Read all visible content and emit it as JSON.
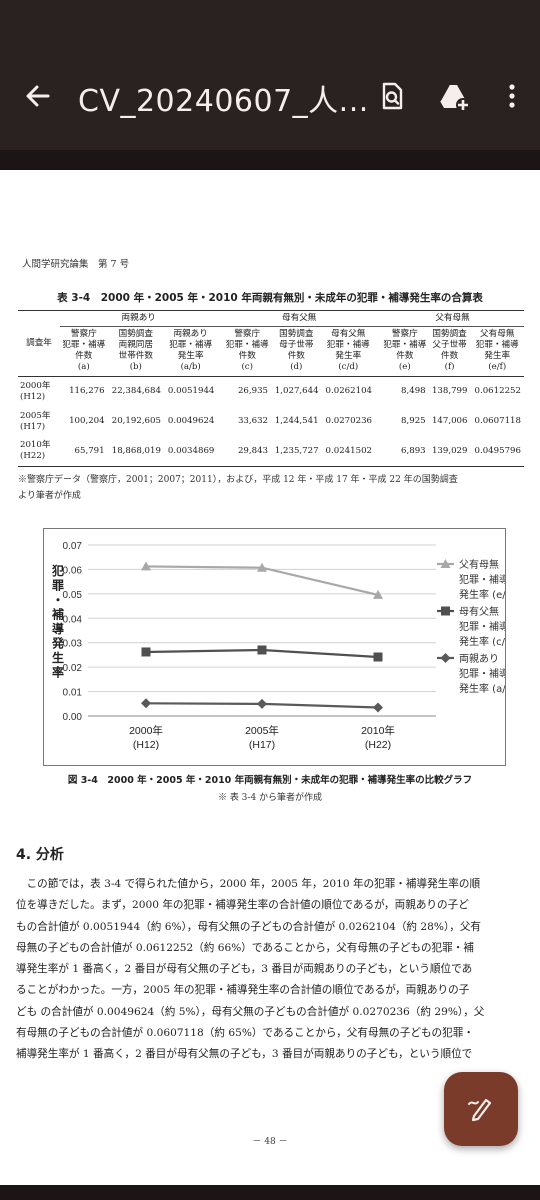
{
  "app": {
    "title": "CV_20240607_人..."
  },
  "page": {
    "header": "人間学研究論集　第 7 号",
    "table_caption": "表 3-4　2000 年・2005 年・2010 年両親有無別・未成年の犯罪・補導発生率の合算表",
    "table": {
      "groups": [
        "両親あり",
        "母有父無",
        "父有母無"
      ],
      "row_header": "調査年",
      "columns": [
        [
          "警察庁",
          "犯罪・補導",
          "件数",
          "(a)"
        ],
        [
          "国勢調査",
          "両親同居",
          "世帯件数",
          "(b)"
        ],
        [
          "両親あり",
          "犯罪・補導",
          "発生率",
          "(a/b)"
        ],
        [
          "警察庁",
          "犯罪・補導",
          "件数",
          "(c)"
        ],
        [
          "国勢調査",
          "母子世帯",
          "件数",
          "(d)"
        ],
        [
          "母有父無",
          "犯罪・補導",
          "発生率",
          "(c/d)"
        ],
        [
          "警察庁",
          "犯罪・補導",
          "件数",
          "(e)"
        ],
        [
          "国勢調査",
          "父子世帯",
          "件数",
          "(f)"
        ],
        [
          "父有母無",
          "犯罪・補導",
          "発生率",
          "(e/f)"
        ]
      ],
      "rows": [
        {
          "year": "2000年",
          "era": "(H12)",
          "values": [
            "116,276",
            "22,384,684",
            "0.0051944",
            "26,935",
            "1,027,644",
            "0.0262104",
            "8,498",
            "138,799",
            "0.0612252"
          ]
        },
        {
          "year": "2005年",
          "era": "(H17)",
          "values": [
            "100,204",
            "20,192,605",
            "0.0049624",
            "33,632",
            "1,244,541",
            "0.0270236",
            "8,925",
            "147,006",
            "0.0607118"
          ]
        },
        {
          "year": "2010年",
          "era": "(H22)",
          "values": [
            "65,791",
            "18,868,019",
            "0.0034869",
            "29,843",
            "1,235,727",
            "0.0241502",
            "6,893",
            "139,029",
            "0.0495796"
          ]
        }
      ],
      "note_line1": "※警察庁データ（警察庁，2001；2007；2011），および，平成 12 年・平成 17 年・平成 22 年の国勢調査",
      "note_line2": "より筆者が作成"
    },
    "chart_caption": "図 3-4　2000 年・2005 年・2010 年両親有無別・未成年の犯罪・補導発生率の比較グラフ",
    "chart_subcaption": "※ 表 3-4 から筆者が作成",
    "section_title": "4. 分析",
    "body_lines": [
      "　この節では，表 3-4 で得られた値から，2000 年，2005 年，2010 年の犯罪・補導発生率の順",
      "位を導きだした。まず，2000 年の犯罪・補導発生率の合計値の順位であるが，両親ありの子ど",
      "もの合計値が 0.0051944（約 6%），母有父無の子どもの合計値が 0.0262104（約 28%），父有",
      "母無の子どもの合計値が 0.0612252（約 66%）であることから，父有母無の子どもの犯罪・補",
      "導発生率が 1 番高く，2 番目が母有父無の子ども，3 番目が両親ありの子ども，という順位であ",
      "ることがわかった。一方，2005 年の犯罪・補導発生率の合計値の順位であるが，両親ありの子",
      "ども の合計値が 0.0049624（約 5%），母有父無の子どもの合計値が 0.0270236（約 29%），父",
      "有母無の子どもの合計値が 0.0607118（約 65%）であることから，父有母無の子どもの犯罪・",
      "補導発生率が 1 番高く，2 番目が母有父無の子ども，3 番目が両親ありの子ども，という順位で"
    ],
    "page_number": "－ 48 －"
  },
  "chart_data": {
    "type": "line",
    "ylabel": "犯罪・補導発生率",
    "ylim": [
      0,
      0.07
    ],
    "yticks": [
      "0.00",
      "0.01",
      "0.02",
      "0.03",
      "0.04",
      "0.05",
      "0.06",
      "0.07"
    ],
    "categories": [
      "2000年",
      "2005年",
      "2010年"
    ],
    "category_sub": [
      "(H12)",
      "(H17)",
      "(H22)"
    ],
    "grid": true,
    "legend_position": "right",
    "series": [
      {
        "name": "父有母無",
        "legend_lines": [
          "父有母無",
          "犯罪・補導",
          "発生率 (e/f)"
        ],
        "marker": "triangle",
        "color": "#a8a8a8",
        "values": [
          0.0612252,
          0.0607118,
          0.0495796
        ]
      },
      {
        "name": "母有父無",
        "legend_lines": [
          "母有父無",
          "犯罪・補導",
          "発生率 (c/d)"
        ],
        "marker": "square",
        "color": "#505050",
        "values": [
          0.0262104,
          0.0270236,
          0.0241502
        ]
      },
      {
        "name": "両親あり",
        "legend_lines": [
          "両親あり",
          "犯罪・補導",
          "発生率 (a/b)"
        ],
        "marker": "diamond",
        "color": "#5a5a5a",
        "values": [
          0.0051944,
          0.0049624,
          0.0034869
        ]
      }
    ]
  }
}
